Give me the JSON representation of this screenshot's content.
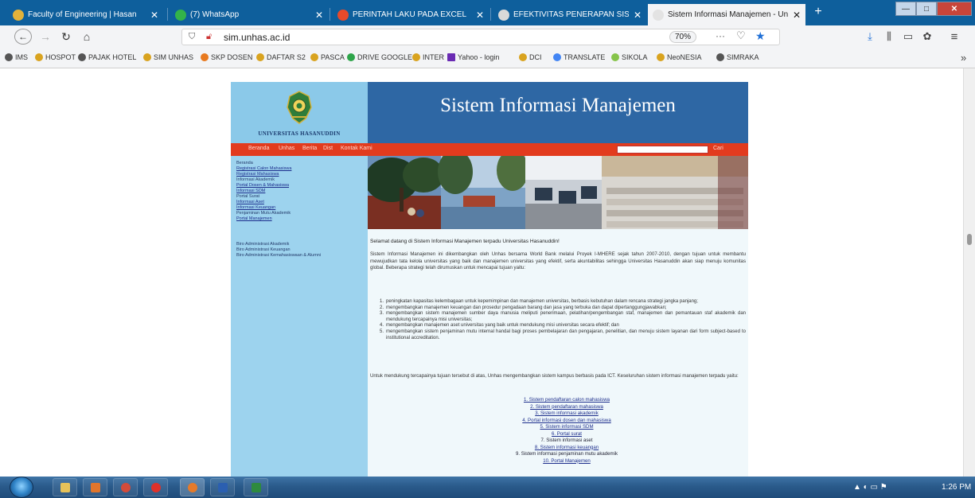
{
  "browser": {
    "tabs": [
      {
        "title": "Faculty of Engineering | Hasan",
        "icon_color": "#e2b23a",
        "active": false
      },
      {
        "title": "(7) WhatsApp",
        "icon_color": "#33b34a",
        "active": false
      },
      {
        "title": "PERINTAH LAKU PADA EXCEL",
        "icon_color": "#e84a2a",
        "active": false
      },
      {
        "title": "EFEKTIVITAS PENERAPAN SISTEM I",
        "icon_color": "#d9d9d9",
        "active": false
      },
      {
        "title": "Sistem Informasi Manajemen - Univ",
        "icon_color": "#e3e3e3",
        "active": true
      }
    ],
    "tab_close_glyph": "✕",
    "new_tab_glyph": "+",
    "window_controls": {
      "minimize": "—",
      "maximize": "□",
      "close": "✕"
    },
    "nav": {
      "back": "←",
      "forward": "→",
      "reload": "↻",
      "home": "⌂"
    },
    "url": "sim.unhas.ac.id",
    "zoom": "70%",
    "url_more": "···",
    "pocket": "♡",
    "star": "★",
    "toolbar_icons": {
      "downloads": "⤓",
      "library": "⫼",
      "sidebar": "▭",
      "extension": "✿",
      "menu": "≡"
    },
    "bookmarks": [
      {
        "label": "IMS",
        "icon_color": "#444444"
      },
      {
        "label": "HOSPOT",
        "icon_color": "#d9a31f"
      },
      {
        "label": "PAJAK HOTEL",
        "icon_color": "#444444"
      },
      {
        "label": "SIM UNHAS",
        "icon_color": "#d9a31f"
      },
      {
        "label": "SKP DOSEN",
        "icon_color": "#e87a20"
      },
      {
        "label": "DAFTAR S2",
        "icon_color": "#d9a31f"
      },
      {
        "label": "PASCA",
        "icon_color": "#d9a31f"
      },
      {
        "label": "DRIVE GOOGLE",
        "icon_color": "#2ea54a"
      },
      {
        "label": "INTER",
        "icon_color": "#d9a31f"
      },
      {
        "label": "Yahoo - login",
        "icon_color": "#6a2bb3"
      },
      {
        "label": "DCI",
        "icon_color": "#d9a31f"
      },
      {
        "label": "TRANSLATE",
        "icon_color": "#4285f4"
      },
      {
        "label": "SIKOLA",
        "icon_color": "#86c44a"
      },
      {
        "label": "NeoNESIA",
        "icon_color": "#d9a31f"
      },
      {
        "label": "SIMRAKA",
        "icon_color": "#444444"
      }
    ],
    "bookmarks_overflow": "»"
  },
  "site": {
    "logo_text": "UNIVERSITAS HASANUDDIN",
    "title": "Sistem Informasi Manajemen",
    "menu": [
      "Beranda",
      "Unhas",
      "Berita",
      "Dist",
      "Kontak Kami"
    ],
    "search_button": "Cari",
    "left_links": [
      {
        "label": "Beranda",
        "underline": false
      },
      {
        "label": "Registrasi Calon Mahasiswa",
        "underline": true
      },
      {
        "label": "Registrasi Mahasiswa",
        "underline": true
      },
      {
        "label": "Informasi Akademik",
        "underline": false
      },
      {
        "label": "Portal Dosen & Mahasiswa",
        "underline": true
      },
      {
        "label": "Informasi SDM",
        "underline": true
      },
      {
        "label": "Portal Surat",
        "underline": false
      },
      {
        "label": "Informasi Aset",
        "underline": true
      },
      {
        "label": "Informasi Keuangan",
        "underline": true
      },
      {
        "label": "Penjaminan Mutu Akademik",
        "underline": false
      },
      {
        "label": "Portal Manajemen",
        "underline": true
      }
    ],
    "left_links_2": [
      "Biro Administrasi Akademik",
      "Biro Administrasi Keuangan",
      "Biro Administrasi Kemahasiswaan & Alumni"
    ],
    "welcome": "Selamat datang di Sistem Informasi Manajemen terpadu Universitas Hasanuddin!",
    "paragraph1": "Sistem Informasi Manajemen ini dikembangkan oleh Unhas bersama World Bank melalui Proyek I-MHERE sejak tahun 2007-2010, dengan tujuan untuk membantu mewujudkan tata kelola universitas yang baik dan manajemen universitas yang efektif, serta akuntabilitas sehingga Universitas Hasanuddin akan siap menuju komunitas global. Beberapa strategi telah dirumuskan untuk mencapai tujuan yaitu:",
    "goals": [
      "peningkatan kapasitas kelembagaan untuk kepemimpinan dan manajemen universitas, berbasis kebutuhan dalam rencana strategi jangka panjang;",
      "mengembangkan manajemen keuangan dan prosedur pengadaan barang dan jasa yang terbuka dan dapat dipertanggungjawabkan;",
      "mengembangkan sistem manajemen sumber daya manusia meliputi penerimaan, pelatihan/pengembangan staf, manajemen dan pemantauan staf akademik dan mendukung tercapainya misi universitas;",
      "mengembangkan manajemen aset universitas yang baik untuk mendukung misi universitas secara efektif; dan",
      "mengembangkan sistem penjaminan mutu internal handal bagi proses pembelajaran dan pengajaran, penelitian, dan menuju sistem layanan dari form subject-based to institutional accreditation."
    ],
    "paragraph2": "Untuk mendukung tercapainya tujuan tersebut di atas, Unhas mengembangkan sistem kampus berbasis pada ICT. Keseluruhan sistem informasi manajemen terpadu yaitu:",
    "systems": [
      {
        "label": "1. Sistem pendaftaran calon mahasiswa",
        "underline": true
      },
      {
        "label": "2. Sistem pendaftaran mahasiswa",
        "underline": true
      },
      {
        "label": "3. Sistem informasi akademik",
        "underline": true
      },
      {
        "label": "4. Portal informasi dosen dan mahasiswa",
        "underline": true
      },
      {
        "label": "5. Sistem informasi SDM",
        "underline": true
      },
      {
        "label": "6. Portal surat",
        "underline": true
      },
      {
        "label": "7. Sistem informasi aset",
        "underline": false
      },
      {
        "label": "8. Sistem informasi keuangan",
        "underline": true
      },
      {
        "label": "9. Sistem informasi penjaminan mutu akademik",
        "underline": false
      },
      {
        "label": "10. Portal Manajemen",
        "underline": true
      }
    ]
  },
  "taskbar": {
    "apps": [
      {
        "name": "explorer",
        "color": "#e6c25a"
      },
      {
        "name": "office",
        "color": "#e0752c"
      },
      {
        "name": "chrome",
        "color": "#d44b3a"
      },
      {
        "name": "opera",
        "color": "#e0312a"
      },
      {
        "name": "firefox",
        "color": "#e57a2a"
      },
      {
        "name": "word",
        "color": "#2b5fb0"
      },
      {
        "name": "excel",
        "color": "#2e8a3f"
      }
    ],
    "tray": "▲  ◐  ▭  ⚑",
    "clock": "1:26 PM"
  }
}
